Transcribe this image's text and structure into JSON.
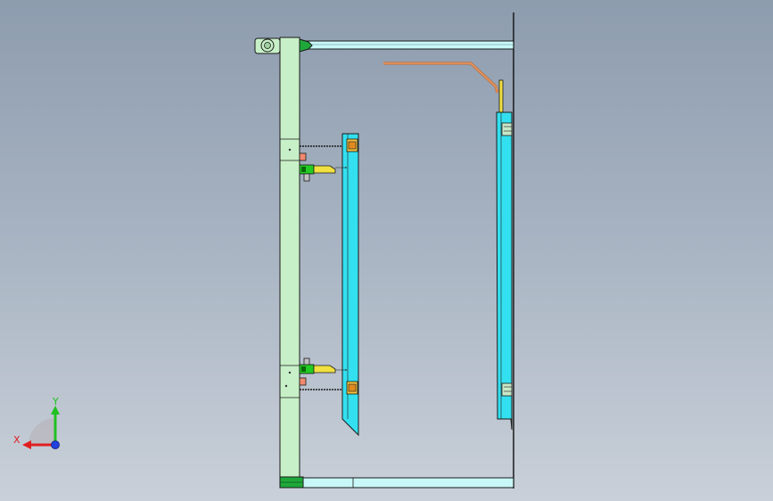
{
  "view": {
    "background_top": "#8d9cae",
    "background_bottom": "#c9d0d9"
  },
  "colors": {
    "frame_green": "#c8f0c8",
    "frame_green_dark": "#1fa83a",
    "cyan_panel": "#33e0f0",
    "beam_cyan": "#c8f8f8",
    "copper": "#e08a4a",
    "yellow": "#f0e040",
    "bright_green": "#22cc22",
    "salmon": "#f08a70",
    "outline": "#1a1a1a"
  },
  "triad": {
    "x_label": "X",
    "y_label": "Y",
    "x_color": "#e02020",
    "y_color": "#20c020",
    "z_color": "#2040e0"
  }
}
